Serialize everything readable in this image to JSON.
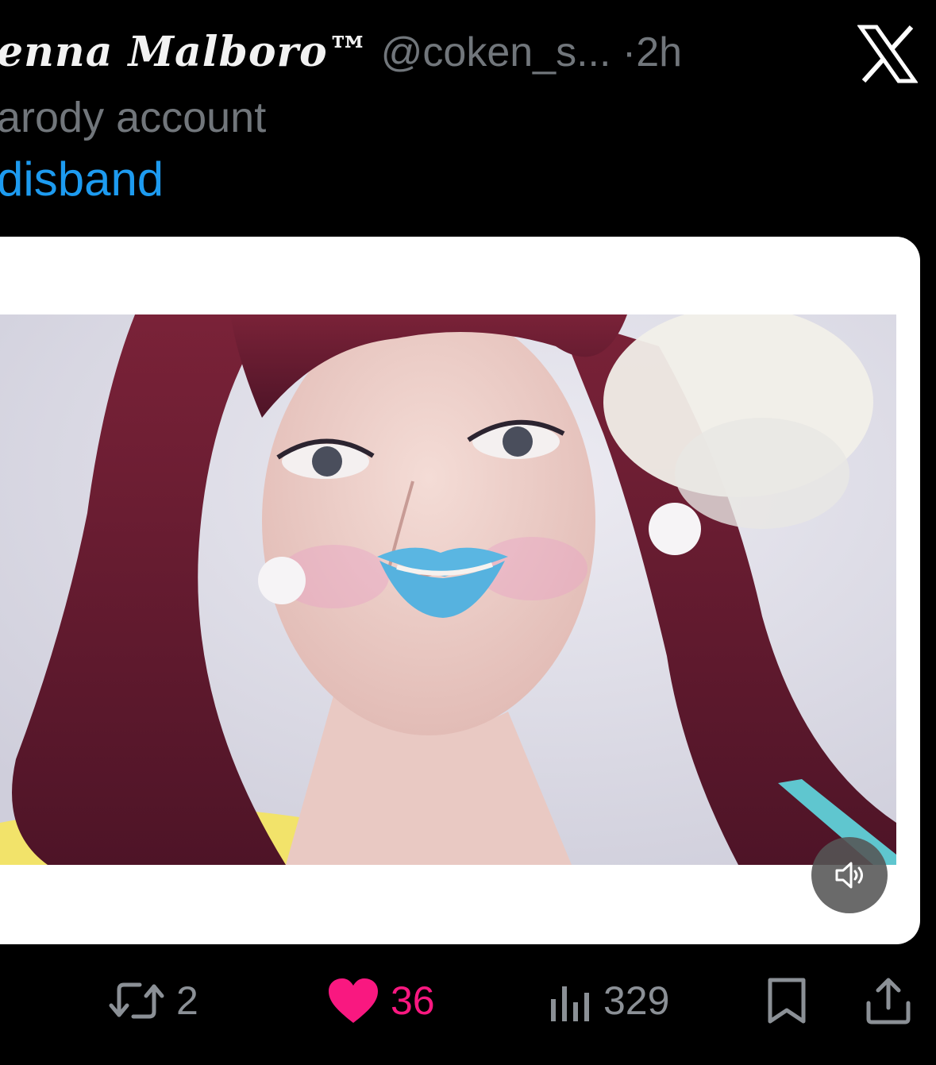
{
  "tweet": {
    "display_name": "enna Malboro™",
    "handle": "@coken_s...",
    "separator": "·",
    "time": "2h",
    "badge": "arody account",
    "text": "disband"
  },
  "brand": {
    "logo_icon": "x-logo-icon"
  },
  "media": {
    "type": "video",
    "mute_icon": "speaker-icon"
  },
  "actions": {
    "retweet": {
      "icon": "retweet-icon",
      "count": "2"
    },
    "like": {
      "icon": "heart-icon",
      "count": "36",
      "color": "#f91880"
    },
    "views": {
      "icon": "views-bar-chart-icon",
      "count": "329"
    },
    "bookmark": {
      "icon": "bookmark-icon"
    },
    "share": {
      "icon": "share-icon"
    }
  },
  "colors": {
    "background": "#000000",
    "link": "#1d9bf0",
    "secondary_text": "#71767b",
    "like": "#f91880"
  }
}
